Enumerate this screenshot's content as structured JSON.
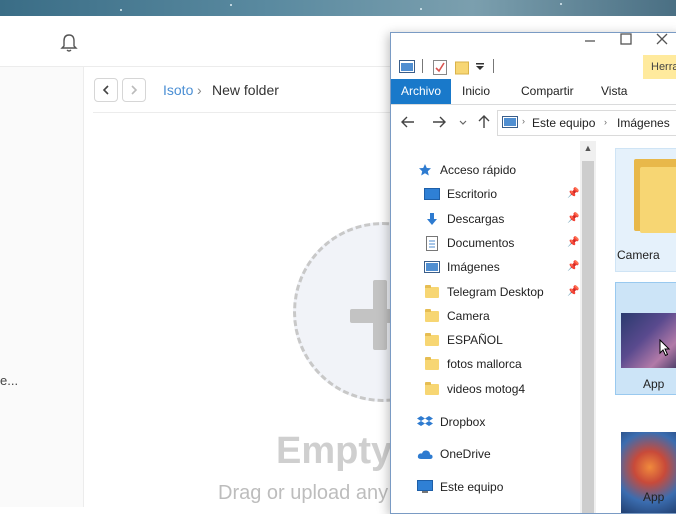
{
  "background_app": {
    "breadcrumb": {
      "root": "Isoto",
      "separator": "›",
      "current": "New folder"
    },
    "empty_state": {
      "title": "Empty",
      "subtitle": "Drag or upload any"
    },
    "sidebar_truncated": "e..."
  },
  "explorer": {
    "ribbon_contextual_tab": "Herra",
    "tabs": [
      {
        "label": "Archivo",
        "active": true
      },
      {
        "label": "Inicio"
      },
      {
        "label": "Compartir"
      },
      {
        "label": "Vista"
      }
    ],
    "address": {
      "segment1": "Este equipo",
      "separator": "›",
      "segment2": "Imágenes"
    },
    "nav": {
      "quick_access": "Acceso rápido",
      "quick_items": [
        {
          "label": "Escritorio",
          "icon": "desktop-icon",
          "pinned": true
        },
        {
          "label": "Descargas",
          "icon": "download-icon",
          "pinned": true
        },
        {
          "label": "Documentos",
          "icon": "document-icon",
          "pinned": true
        },
        {
          "label": "Imágenes",
          "icon": "pictures-icon",
          "pinned": true
        },
        {
          "label": "Telegram Desktop",
          "icon": "folder-icon",
          "pinned": true
        },
        {
          "label": "Camera",
          "icon": "folder-icon"
        },
        {
          "label": "ESPAÑOL",
          "icon": "folder-icon"
        },
        {
          "label": "fotos mallorca",
          "icon": "folder-icon"
        },
        {
          "label": "videos motog4",
          "icon": "folder-icon"
        }
      ],
      "dropbox": "Dropbox",
      "onedrive": "OneDrive",
      "this_pc": "Este equipo"
    },
    "files": [
      {
        "label": "Camera",
        "type": "folder"
      },
      {
        "label": "App",
        "type": "image",
        "selected": true
      },
      {
        "label": "App",
        "type": "image"
      }
    ]
  },
  "colors": {
    "accent_blue": "#1979ca",
    "link_blue": "#4b8fd4",
    "selection": "#cce4f7",
    "folder_yellow": "#f7d673",
    "contextual_tab": "#ffea9d"
  }
}
